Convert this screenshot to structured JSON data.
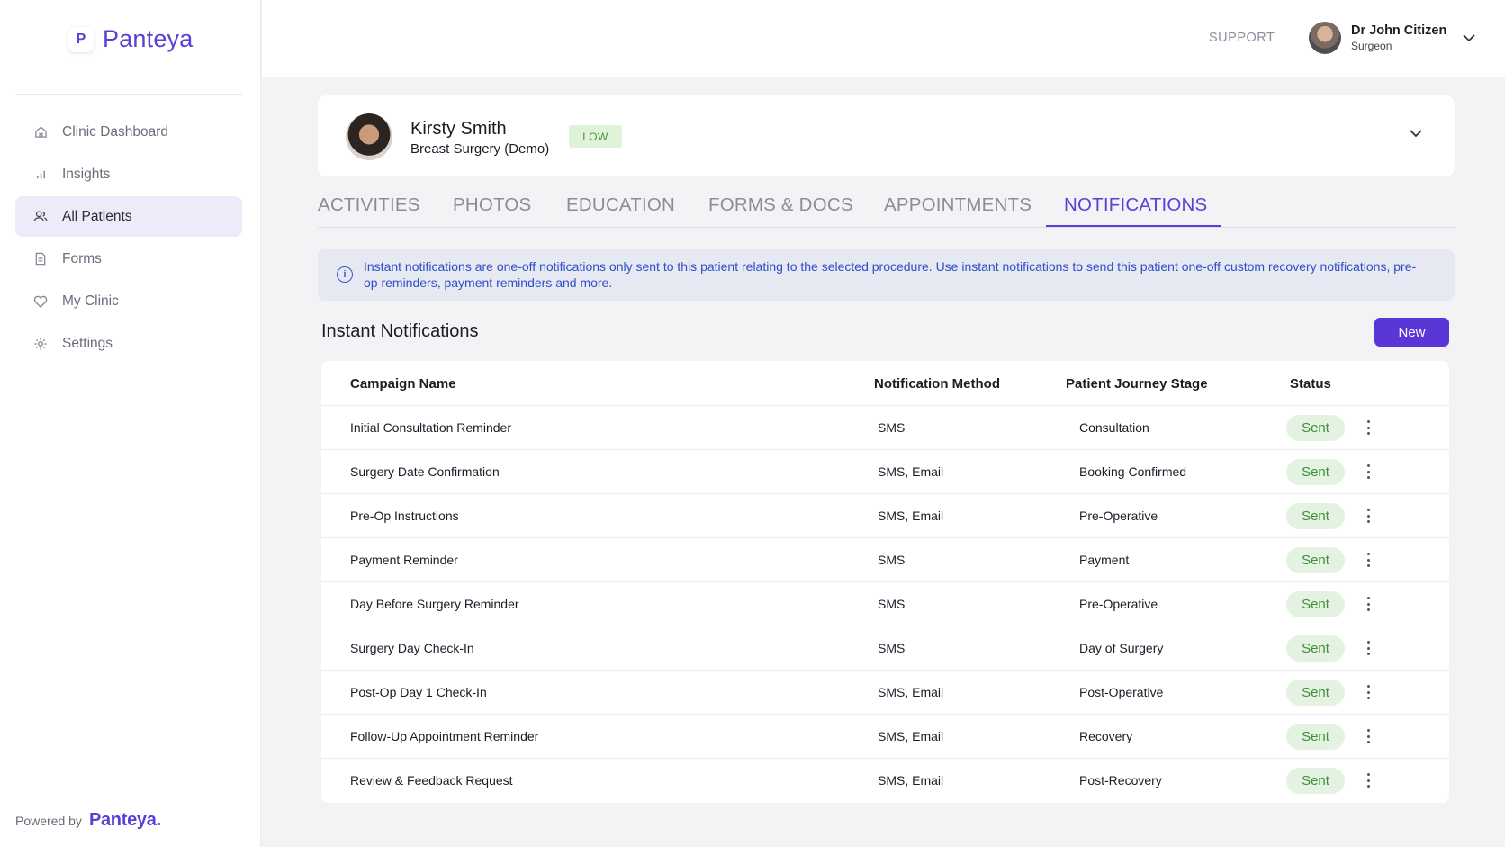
{
  "brand": {
    "name": "Panteya",
    "mark": "P",
    "powered_by_label": "Powered by",
    "powered_by_brand": "Panteya."
  },
  "sidebar": {
    "items": [
      {
        "label": "Clinic Dashboard",
        "icon": "home-icon",
        "active": false
      },
      {
        "label": "Insights",
        "icon": "bar-chart-icon",
        "active": false
      },
      {
        "label": "All Patients",
        "icon": "users-icon",
        "active": true
      },
      {
        "label": "Forms",
        "icon": "document-icon",
        "active": false
      },
      {
        "label": "My Clinic",
        "icon": "heart-icon",
        "active": false
      },
      {
        "label": "Settings",
        "icon": "gear-icon",
        "active": false
      }
    ]
  },
  "header": {
    "support_label": "SUPPORT",
    "user": {
      "name": "Dr John Citizen",
      "role": "Surgeon"
    }
  },
  "patient": {
    "name": "Kirsty Smith",
    "procedure": "Breast Surgery (Demo)",
    "risk_badge": "LOW"
  },
  "tabs": [
    {
      "label": "ACTIVITIES",
      "active": false
    },
    {
      "label": "PHOTOS",
      "active": false
    },
    {
      "label": "EDUCATION",
      "active": false
    },
    {
      "label": "FORMS & DOCS",
      "active": false
    },
    {
      "label": "APPOINTMENTS",
      "active": false
    },
    {
      "label": "NOTIFICATIONS",
      "active": true
    }
  ],
  "info_banner": {
    "text": "Instant notifications are one-off notifications only sent to this patient relating to the selected procedure. Use instant notifications to send this patient one-off custom recovery notifications, pre-op reminders, payment reminders and more."
  },
  "section": {
    "title": "Instant Notifications",
    "new_button": "New"
  },
  "table": {
    "columns": [
      "Campaign Name",
      "Notification Method",
      "Patient Journey Stage",
      "Status"
    ],
    "rows": [
      {
        "name": "Initial Consultation Reminder",
        "method": "SMS",
        "stage": "Consultation",
        "status": "Sent"
      },
      {
        "name": "Surgery Date Confirmation",
        "method": "SMS, Email",
        "stage": "Booking Confirmed",
        "status": "Sent"
      },
      {
        "name": "Pre-Op Instructions",
        "method": "SMS, Email",
        "stage": "Pre-Operative",
        "status": "Sent"
      },
      {
        "name": "Payment Reminder",
        "method": "SMS",
        "stage": "Payment",
        "status": "Sent"
      },
      {
        "name": "Day Before Surgery Reminder",
        "method": "SMS",
        "stage": "Pre-Operative",
        "status": "Sent"
      },
      {
        "name": "Surgery Day Check-In",
        "method": "SMS",
        "stage": "Day of Surgery",
        "status": "Sent"
      },
      {
        "name": "Post-Op Day 1 Check-In",
        "method": "SMS, Email",
        "stage": "Post-Operative",
        "status": "Sent"
      },
      {
        "name": "Follow-Up Appointment Reminder",
        "method": "SMS, Email",
        "stage": "Recovery",
        "status": "Sent"
      },
      {
        "name": "Review & Feedback Request",
        "method": "SMS, Email",
        "stage": "Post-Recovery",
        "status": "Sent"
      }
    ]
  },
  "colors": {
    "brand": "#5b3fd6",
    "status_green": "#3f8f3b",
    "info_blue": "#2f4fc6"
  }
}
